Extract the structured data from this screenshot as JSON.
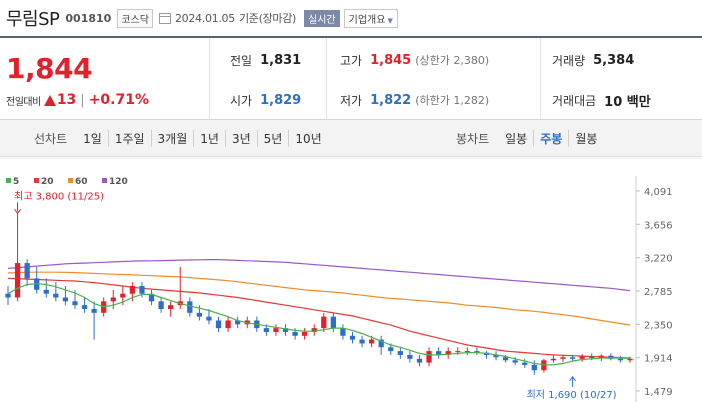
{
  "header": {
    "name": "무림SP",
    "code": "001810",
    "market": "코스닥",
    "date": "2024.01.05",
    "basis": "기준(장마감)",
    "realtime_label": "실시간",
    "company_label": "기업개요"
  },
  "quote": {
    "price": "1,844",
    "change_label": "전일대비",
    "change_value": "13",
    "change_sep": "|",
    "change_pct": "+0.71%",
    "prev": {
      "label": "전일",
      "value": "1,831"
    },
    "high": {
      "label": "고가",
      "value": "1,845",
      "sub": "(상한가 2,380)"
    },
    "volume": {
      "label": "거래량",
      "value": "5,384"
    },
    "open": {
      "label": "시가",
      "value": "1,829"
    },
    "low": {
      "label": "저가",
      "value": "1,822",
      "sub": "(하한가 1,282)"
    },
    "amount": {
      "label": "거래대금",
      "value": "10 백만"
    }
  },
  "periods": {
    "line_label": "선차트",
    "line_items": [
      "1일",
      "1주일",
      "3개월",
      "1년",
      "3년",
      "5년",
      "10년"
    ],
    "candle_label": "봉차트",
    "candle_items": [
      "일봉",
      "주봉",
      "월봉"
    ],
    "active_candle": "주봉"
  },
  "colors": {
    "up": "#e1222c",
    "down": "#2f6ec7",
    "ma5": "#4cb050",
    "ma20": "#e53935",
    "ma60": "#f08c2c",
    "ma120": "#9a58c8"
  },
  "chart_data": {
    "type": "candlestick",
    "legend": [
      {
        "name": "5",
        "color": "#4cb050"
      },
      {
        "name": "20",
        "color": "#e53935"
      },
      {
        "name": "60",
        "color": "#f08c2c"
      },
      {
        "name": "120",
        "color": "#9a58c8"
      }
    ],
    "y_ticks": [
      "4,091",
      "3,656",
      "3,220",
      "2,785",
      "2,350",
      "1,914",
      "1,479"
    ],
    "y_tick_values": [
      4091,
      3656,
      3220,
      2785,
      2350,
      1914,
      1479
    ],
    "ylim": [
      1479,
      4091
    ],
    "annotation_high": {
      "text": "최고 3,800 (11/25)",
      "value": 3800,
      "index": 1
    },
    "annotation_low": {
      "text": "최저 1,690 (10/27)",
      "value": 1690,
      "index": 59
    },
    "candles": [
      [
        2750,
        2850,
        2600,
        2700
      ],
      [
        2700,
        3800,
        2650,
        3150
      ],
      [
        3150,
        3200,
        2850,
        2950
      ],
      [
        2950,
        3100,
        2750,
        2800
      ],
      [
        2800,
        2950,
        2700,
        2750
      ],
      [
        2750,
        2900,
        2650,
        2700
      ],
      [
        2700,
        2850,
        2600,
        2650
      ],
      [
        2650,
        2800,
        2550,
        2600
      ],
      [
        2600,
        2700,
        2500,
        2550
      ],
      [
        2550,
        2650,
        2150,
        2500
      ],
      [
        2500,
        2700,
        2450,
        2650
      ],
      [
        2650,
        2800,
        2550,
        2700
      ],
      [
        2700,
        2850,
        2600,
        2750
      ],
      [
        2750,
        2900,
        2650,
        2850
      ],
      [
        2850,
        2900,
        2700,
        2750
      ],
      [
        2750,
        2800,
        2600,
        2650
      ],
      [
        2650,
        2700,
        2500,
        2550
      ],
      [
        2550,
        2650,
        2450,
        2600
      ],
      [
        2600,
        3100,
        2550,
        2650
      ],
      [
        2650,
        2700,
        2450,
        2500
      ],
      [
        2500,
        2600,
        2400,
        2450
      ],
      [
        2450,
        2550,
        2350,
        2400
      ],
      [
        2400,
        2450,
        2250,
        2300
      ],
      [
        2300,
        2450,
        2250,
        2400
      ],
      [
        2400,
        2450,
        2300,
        2350
      ],
      [
        2350,
        2450,
        2300,
        2400
      ],
      [
        2400,
        2450,
        2250,
        2300
      ],
      [
        2300,
        2350,
        2200,
        2250
      ],
      [
        2250,
        2350,
        2200,
        2300
      ],
      [
        2300,
        2350,
        2200,
        2250
      ],
      [
        2250,
        2300,
        2150,
        2200
      ],
      [
        2200,
        2300,
        2150,
        2250
      ],
      [
        2250,
        2350,
        2200,
        2300
      ],
      [
        2300,
        2500,
        2250,
        2450
      ],
      [
        2450,
        2500,
        2250,
        2300
      ],
      [
        2300,
        2350,
        2150,
        2200
      ],
      [
        2200,
        2250,
        2100,
        2150
      ],
      [
        2150,
        2200,
        2050,
        2100
      ],
      [
        2100,
        2200,
        2050,
        2150
      ],
      [
        2150,
        2200,
        1950,
        2050
      ],
      [
        2050,
        2100,
        1950,
        2000
      ],
      [
        2000,
        2050,
        1900,
        1950
      ],
      [
        1950,
        2000,
        1850,
        1900
      ],
      [
        1900,
        1950,
        1800,
        1850
      ],
      [
        1850,
        2050,
        1800,
        2000
      ],
      [
        2000,
        2050,
        1900,
        1950
      ],
      [
        1950,
        2050,
        1900,
        2000
      ],
      [
        2000,
        2050,
        1950,
        2000
      ],
      [
        2000,
        2050,
        1950,
        2000
      ],
      [
        2000,
        2050,
        1950,
        1980
      ],
      [
        1980,
        2000,
        1900,
        1950
      ],
      [
        1950,
        2000,
        1880,
        1920
      ],
      [
        1920,
        1950,
        1850,
        1880
      ],
      [
        1880,
        1920,
        1820,
        1850
      ],
      [
        1850,
        1900,
        1780,
        1820
      ],
      [
        1820,
        1880,
        1690,
        1750
      ],
      [
        1750,
        1900,
        1720,
        1880
      ],
      [
        1880,
        1950,
        1850,
        1900
      ],
      [
        1900,
        1950,
        1860,
        1920
      ],
      [
        1920,
        1950,
        1870,
        1900
      ],
      [
        1900,
        1960,
        1860,
        1930
      ],
      [
        1930,
        1970,
        1880,
        1910
      ],
      [
        1910,
        1960,
        1870,
        1940
      ],
      [
        1940,
        1970,
        1880,
        1900
      ],
      [
        1900,
        1940,
        1850,
        1880
      ],
      [
        1880,
        1930,
        1850,
        1900
      ]
    ],
    "ma5": [
      2750,
      2820,
      2870,
      2880,
      2870,
      2840,
      2800,
      2760,
      2700,
      2620,
      2580,
      2600,
      2640,
      2700,
      2740,
      2740,
      2700,
      2660,
      2620,
      2590,
      2560,
      2530,
      2490,
      2450,
      2400,
      2370,
      2350,
      2330,
      2310,
      2290,
      2270,
      2260,
      2260,
      2280,
      2300,
      2300,
      2270,
      2230,
      2180,
      2130,
      2080,
      2050,
      2010,
      1970,
      1950,
      1950,
      1960,
      1970,
      1980,
      1980,
      1970,
      1950,
      1930,
      1900,
      1870,
      1840,
      1820,
      1820,
      1840,
      1870,
      1890,
      1900,
      1910,
      1910,
      1910,
      1905
    ],
    "ma20": [
      2950,
      2945,
      2940,
      2935,
      2930,
      2925,
      2920,
      2915,
      2905,
      2895,
      2880,
      2865,
      2850,
      2835,
      2820,
      2810,
      2800,
      2790,
      2780,
      2770,
      2760,
      2745,
      2730,
      2715,
      2700,
      2680,
      2660,
      2640,
      2620,
      2600,
      2580,
      2560,
      2540,
      2520,
      2500,
      2480,
      2460,
      2430,
      2400,
      2370,
      2340,
      2300,
      2260,
      2230,
      2200,
      2170,
      2140,
      2110,
      2080,
      2060,
      2040,
      2020,
      2000,
      1990,
      1980,
      1970,
      1960,
      1950,
      1945,
      1940,
      1935,
      1930,
      1925,
      1920,
      1915,
      1910
    ],
    "ma60": [
      3020,
      3025,
      3030,
      3030,
      3030,
      3030,
      3028,
      3025,
      3020,
      3015,
      3010,
      3005,
      3000,
      2995,
      2990,
      2985,
      2980,
      2975,
      2970,
      2960,
      2950,
      2940,
      2930,
      2920,
      2905,
      2890,
      2875,
      2860,
      2845,
      2830,
      2815,
      2800,
      2790,
      2780,
      2770,
      2760,
      2745,
      2730,
      2715,
      2700,
      2690,
      2680,
      2670,
      2660,
      2650,
      2640,
      2630,
      2615,
      2600,
      2590,
      2580,
      2570,
      2555,
      2540,
      2530,
      2520,
      2505,
      2490,
      2475,
      2460,
      2440,
      2420,
      2400,
      2380,
      2360,
      2340
    ],
    "ma120": [
      3080,
      3090,
      3100,
      3110,
      3120,
      3130,
      3140,
      3145,
      3150,
      3155,
      3160,
      3165,
      3170,
      3175,
      3178,
      3180,
      3182,
      3185,
      3188,
      3190,
      3192,
      3195,
      3195,
      3190,
      3185,
      3180,
      3175,
      3170,
      3165,
      3160,
      3150,
      3140,
      3130,
      3120,
      3110,
      3100,
      3090,
      3080,
      3070,
      3060,
      3050,
      3040,
      3030,
      3020,
      3010,
      3000,
      2990,
      2980,
      2970,
      2960,
      2950,
      2940,
      2930,
      2920,
      2910,
      2900,
      2890,
      2880,
      2870,
      2860,
      2850,
      2840,
      2830,
      2820,
      2805,
      2790
    ]
  }
}
